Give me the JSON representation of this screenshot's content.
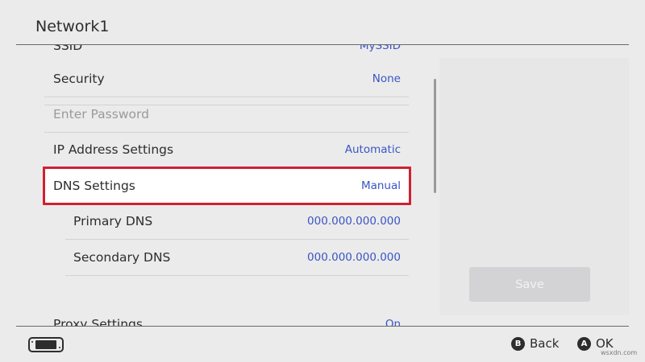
{
  "header": {
    "title": "Network1"
  },
  "list": {
    "rows": [
      {
        "label": "SSID",
        "value": "MySSID"
      },
      {
        "label": "Security",
        "value": "None"
      },
      {
        "label": "Enter Password",
        "value": ""
      },
      {
        "label": "IP Address Settings",
        "value": "Automatic"
      },
      {
        "label": "DNS Settings",
        "value": "Manual"
      },
      {
        "label": "Primary DNS",
        "value": "000.000.000.000"
      },
      {
        "label": "Secondary DNS",
        "value": "000.000.000.000"
      },
      {
        "label": "Proxy Settings",
        "value": "On"
      }
    ]
  },
  "right_panel": {
    "save_label": "Save"
  },
  "footer": {
    "back": {
      "key": "B",
      "label": "Back"
    },
    "ok": {
      "key": "A",
      "label": "OK"
    }
  },
  "watermark": "wsxdn.com",
  "colors": {
    "highlight_border": "#d12030",
    "value_text": "#3a55c4",
    "background": "#ebebeb"
  }
}
